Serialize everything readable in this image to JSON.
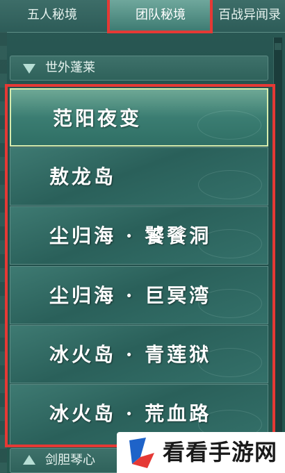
{
  "tabs": [
    {
      "label": "五人秘境",
      "active": false
    },
    {
      "label": "团队秘境",
      "active": true
    },
    {
      "label": "百战异闻录",
      "active": false
    }
  ],
  "categories": [
    {
      "label": "世外蓬莱",
      "expanded": true
    },
    {
      "label": "剑胆琴心",
      "expanded": false
    }
  ],
  "dungeons": [
    {
      "label": "范阳夜变",
      "selected": true
    },
    {
      "label": "敖龙岛",
      "selected": false
    },
    {
      "label": "尘归海 · 饕餮洞",
      "selected": false
    },
    {
      "label": "尘归海 · 巨冥湾",
      "selected": false
    },
    {
      "label": "冰火岛 · 青莲狱",
      "selected": false
    },
    {
      "label": "冰火岛 · 荒血路",
      "selected": false
    }
  ],
  "watermark": {
    "text": "看看手游网"
  },
  "colors": {
    "highlight": "#e53935",
    "accent": "#3c7a71"
  }
}
